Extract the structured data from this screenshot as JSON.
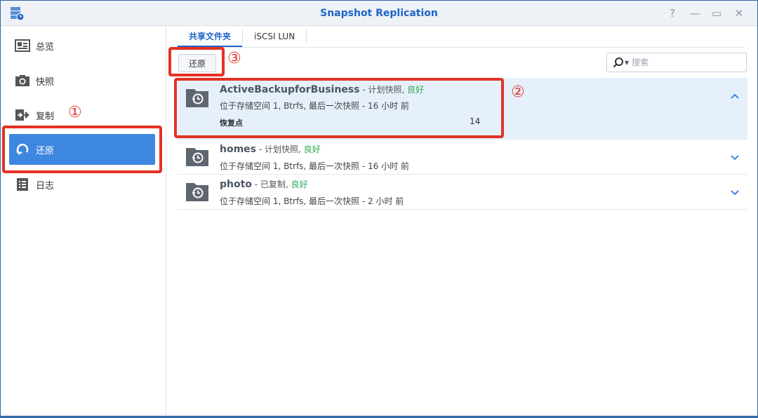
{
  "window": {
    "title": "Snapshot Replication",
    "help": "?",
    "minimize": "—",
    "maximize": "▭",
    "close": "✕"
  },
  "sidebar": {
    "items": [
      {
        "label": "总览",
        "icon": "overview-icon"
      },
      {
        "label": "快照",
        "icon": "camera-icon"
      },
      {
        "label": "复制",
        "icon": "replication-icon"
      },
      {
        "label": "还原",
        "icon": "restore-icon",
        "active": true
      },
      {
        "label": "日志",
        "icon": "log-icon"
      }
    ]
  },
  "annotations": {
    "one": "①",
    "two": "②",
    "three": "③"
  },
  "tabs": [
    {
      "label": "共享文件夹",
      "active": true
    },
    {
      "label": "iSCSI LUN"
    }
  ],
  "toolbar": {
    "restore_label": "还原"
  },
  "search": {
    "placeholder": "搜索"
  },
  "rows": [
    {
      "name": "ActiveBackupforBusiness",
      "meta": " - 计划快照, ",
      "status": "良好",
      "sub": "位于存储空间 1, Btrfs, 最后一次快照 - 16 小时 前",
      "point_label": "恢复点",
      "point_count": "14",
      "expanded": true
    },
    {
      "name": "homes",
      "meta": " - 计划快照, ",
      "status": "良好",
      "sub": "位于存储空间 1, Btrfs, 最后一次快照 - 16 小时 前"
    },
    {
      "name": "photo",
      "meta": " - 已复制, ",
      "status": "良好",
      "sub": "位于存储空间 1, Btrfs, 最后一次快照 - 2 小时 前"
    }
  ],
  "colors": {
    "accent": "#1e64c8",
    "active_nav": "#3e87e0",
    "status_ok": "#2fa84f",
    "highlight": "#e33225"
  }
}
